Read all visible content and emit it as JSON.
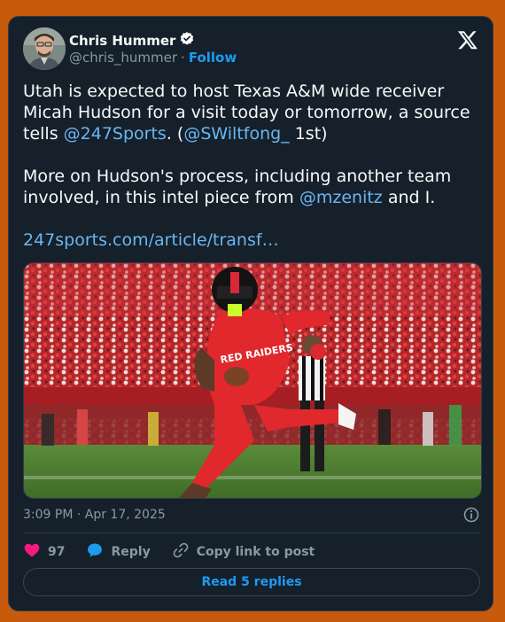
{
  "author": {
    "name": "Chris Hummer",
    "handle": "@chris_hummer",
    "separator": "·",
    "follow_label": "Follow"
  },
  "tweet": {
    "line1_text": "Utah is expected to host Texas A&M wide receiver Micah Hudson for a visit today or tomorrow, a source tells ",
    "mention_247": "@247Sports",
    "line1_mid": ". (",
    "mention_swiltfong": "@SWiltfong_",
    "line1_end": " 1st)",
    "line2_text": "More on Hudson's process, including another team involved, in this intel piece from ",
    "mention_mzenitz": "@mzenitz",
    "line2_end": " and I.",
    "link_text": "247sports.com/article/transf…"
  },
  "media": {
    "jersey_text": "RED RAIDERS"
  },
  "timestamp": "3:09 PM · Apr 17, 2025",
  "actions": {
    "like_count": "97",
    "reply_label": "Reply",
    "copy_label": "Copy link to post"
  },
  "read_replies_label": "Read 5 replies",
  "colors": {
    "background": "#c85a0c",
    "card": "#15202b",
    "accent": "#1d9bf0",
    "like": "#f91880"
  }
}
